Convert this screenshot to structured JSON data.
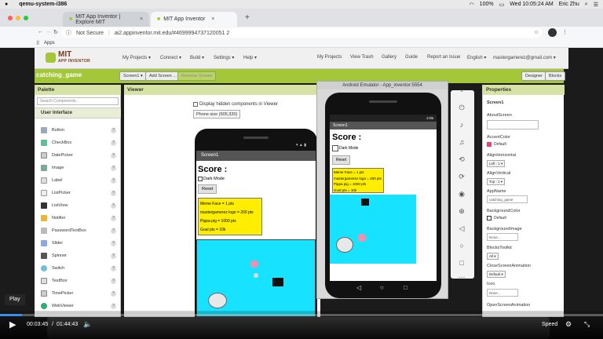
{
  "menubar": {
    "app_name": "qemu-system-i386",
    "battery": "100%",
    "clock": "Wed 10:05:24 AM",
    "user": "Eric Zhu"
  },
  "browser": {
    "tabs": [
      {
        "label": "MIT App Inventor | Explore MIT"
      },
      {
        "label": "MIT App Inventor"
      }
    ],
    "new_tab_symbol": "+",
    "security": "Not Secure",
    "url": "ai2.appinventor.mit.edu/#4699994737120051 2",
    "bookmarks_label": "Apps"
  },
  "appinventor": {
    "logo_title": "MIT",
    "logo_subtitle": "APP INVENTOR",
    "menu_left": [
      "My Projects ▾",
      "Connect ▾",
      "Build ▾",
      "Settings ▾",
      "Help ▾"
    ],
    "menu_right": [
      "My Projects",
      "View Trash",
      "Gallery",
      "Guide",
      "Report an Issue",
      "English ▾",
      "mastergamerez@gmail.com ▾"
    ],
    "project_name": "catching_game",
    "screen_select": "Screen1 ▾",
    "add_screen": "Add Screen ...",
    "remove_screen": "Remove Screen",
    "designer": "Designer",
    "blocks": "Blocks"
  },
  "palette": {
    "title": "Palette",
    "search_placeholder": "Search Components...",
    "section": "User Interface",
    "items": [
      "Button",
      "CheckBox",
      "DatePicker",
      "Image",
      "Label",
      "ListPicker",
      "ListView",
      "Notifier",
      "PasswordTextBox",
      "Slider",
      "Spinner",
      "Switch",
      "TextBox",
      "TimePicker",
      "WebViewer"
    ]
  },
  "viewer": {
    "title": "Viewer",
    "hidden_components": "Display hidden components in Viewer",
    "phone_size": "Phone size (505,320)",
    "screen_title": "Screen1",
    "score_label": "Score :",
    "dark_mode": "Dark Mode",
    "reset": "Reset",
    "points": [
      "Meme Face = 1 pts",
      "mastergamerez logo = 200 pts",
      "Pippa pig = 1000 pts",
      "Goal pts = 10k"
    ]
  },
  "emulator": {
    "title": "Android Emulator - App_inventor:5554",
    "status_time": "2:05",
    "screen_title": "Screen1",
    "score_label": "Score :",
    "dark_mode": "Dark Mode",
    "reset": "Reset",
    "points": [
      "Meme Face = 1 pts",
      "mastergamerez logo = 200 pts",
      "Pippa pig = 1000 pts",
      "Goal pts = 10k"
    ]
  },
  "properties": {
    "title": "Properties",
    "component": "Screen1",
    "about_screen": "AboutScreen",
    "accent_color": "AccentColor",
    "accent_value": "Default",
    "align_h": "AlignHorizontal",
    "align_h_value": "Left : 1 ▾",
    "align_v": "AlignVertical",
    "align_v_value": "Top : 1 ▾",
    "app_name": "AppName",
    "app_name_value": "catching_game",
    "bg_color": "BackgroundColor",
    "bg_color_value": "Default",
    "bg_image": "BackgroundImage",
    "bg_image_value": "None...",
    "blocks_toolkit": "BlocksToolkit",
    "blocks_toolkit_value": "All ▾",
    "close_anim": "CloseScreenAnimation",
    "close_anim_value": "Default ▾",
    "icon": "Icon",
    "icon_value": "None...",
    "open_anim": "OpenScreenAnimation"
  },
  "video": {
    "play_tooltip": "Play",
    "current_time": "00:03:45",
    "separator": "/",
    "total_time": "01:44:43",
    "speed": "Speed",
    "progress_fraction": 0.036
  },
  "colors": {
    "ai_green": "#a4c639",
    "canvas_cyan": "#17e2ff",
    "label_yellow": "#ffee00"
  }
}
